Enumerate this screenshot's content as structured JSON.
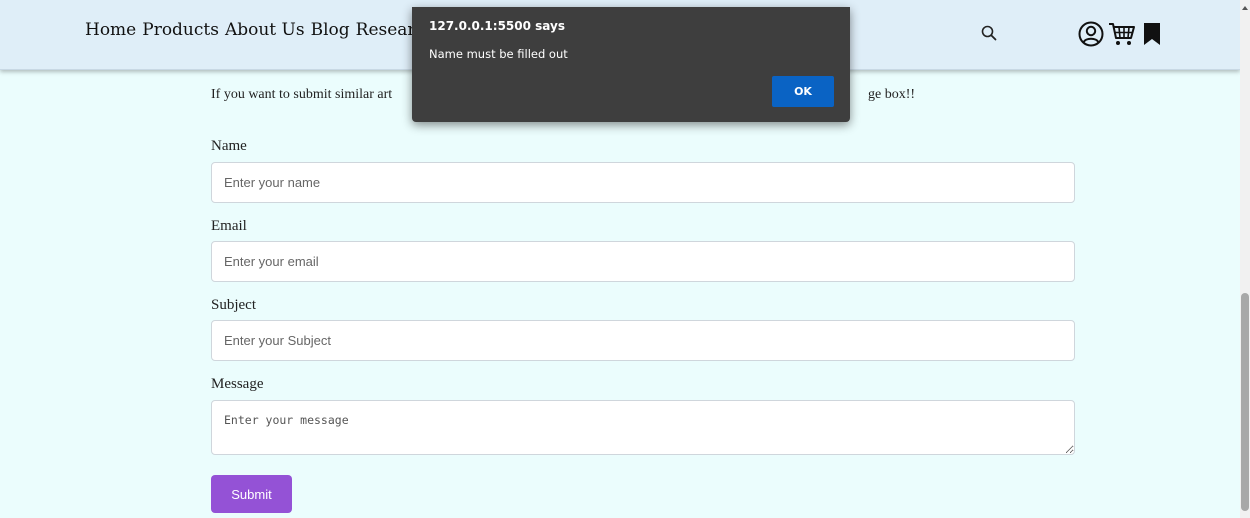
{
  "nav": {
    "items": [
      "Home",
      "Products",
      "About Us",
      "Blog",
      "Research"
    ]
  },
  "header_icons": [
    "search-icon",
    "user-icon",
    "cart-icon",
    "bookmark-icon"
  ],
  "intro": {
    "left_text": "If you want to submit similar art",
    "right_text": "ge box!!"
  },
  "form": {
    "name_label": "Name",
    "name_placeholder": "Enter your name",
    "email_label": "Email",
    "email_placeholder": "Enter your email",
    "subject_label": "Subject",
    "subject_placeholder": "Enter your Subject",
    "message_label": "Message",
    "message_placeholder": "Enter your message",
    "submit_label": "Submit"
  },
  "dialog": {
    "title": "127.0.0.1:5500 says",
    "message": "Name must be filled out",
    "ok_label": "OK"
  },
  "colors": {
    "header_bg": "#dfeef8",
    "page_bg": "#ebfdfd",
    "submit_bg": "#9452d6",
    "dialog_bg": "#3e3e3e",
    "ok_bg": "#0a63c4"
  }
}
